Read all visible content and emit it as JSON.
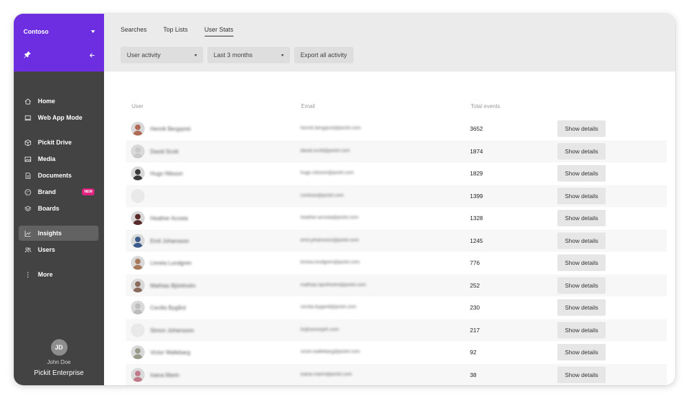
{
  "sidebar": {
    "org_name": "Contoso",
    "nav": [
      {
        "label": "Home",
        "icon": "home-icon"
      },
      {
        "label": "Web App Mode",
        "icon": "laptop-icon"
      },
      {
        "label": "Pickit Drive",
        "icon": "box-icon"
      },
      {
        "label": "Media",
        "icon": "image-icon"
      },
      {
        "label": "Documents",
        "icon": "document-icon"
      },
      {
        "label": "Brand",
        "icon": "palette-icon",
        "badge": "NEW"
      },
      {
        "label": "Boards",
        "icon": "layers-icon"
      },
      {
        "label": "Insights",
        "icon": "chart-line-icon",
        "active": true
      },
      {
        "label": "Users",
        "icon": "users-icon"
      },
      {
        "label": "More",
        "icon": "more-vertical-icon"
      }
    ],
    "user": {
      "initials": "JD",
      "name": "John Doe"
    },
    "plan": "Pickit Enterprise"
  },
  "header": {
    "tabs": [
      {
        "label": "Searches",
        "active": false
      },
      {
        "label": "Top Lists",
        "active": false
      },
      {
        "label": "User Stats",
        "active": true
      }
    ],
    "activity_select": "User activity",
    "period_select": "Last 3 months",
    "export_label": "Export all activity"
  },
  "table": {
    "columns": [
      "User",
      "Email",
      "Total events",
      ""
    ],
    "details_label": "Show details",
    "rows": [
      {
        "name": "Henrik Bergqvist",
        "email": "henrik.bergqvist@pickit.com",
        "events": "3652",
        "avatar": "#b06a55"
      },
      {
        "name": "David Scott",
        "email": "david.scott@pickit.com",
        "events": "1874",
        "avatar": "#c9c9c9"
      },
      {
        "name": "Hugo Nilsson",
        "email": "hugo.nilsson@pickit.com",
        "events": "1829",
        "avatar": "#3a3a3a"
      },
      {
        "name": "",
        "email": "contoso@pickit.com",
        "events": "1399",
        "avatar": ""
      },
      {
        "name": "Heather Acosta",
        "email": "heather.acosta@pickit.com",
        "events": "1328",
        "avatar": "#5a2a2a"
      },
      {
        "name": "Emil Johansson",
        "email": "emil.johansson@pickit.com",
        "events": "1245",
        "avatar": "#3c5a8a"
      },
      {
        "name": "Linnéa Lundgren",
        "email": "linnea.lundgren@pickit.com",
        "events": "776",
        "avatar": "#a87a5c"
      },
      {
        "name": "Mathias Björkholm",
        "email": "mathias.bjorkholm@pickit.com",
        "events": "252",
        "avatar": "#8a6a5a"
      },
      {
        "name": "Cecilia Bygård",
        "email": "cecilia.bygard@pickit.com",
        "events": "230",
        "avatar": "#bdbdbd"
      },
      {
        "name": "Simon Johansson",
        "email": "hi@simonjoh.com",
        "events": "217",
        "avatar": ""
      },
      {
        "name": "Victor Wallebarg",
        "email": "victor.wallebarg@pickit.com",
        "events": "92",
        "avatar": "#9a9a8a"
      },
      {
        "name": "Ioana Marin",
        "email": "ioana.marin@pickit.com",
        "events": "38",
        "avatar": "#c07a8a"
      }
    ]
  }
}
